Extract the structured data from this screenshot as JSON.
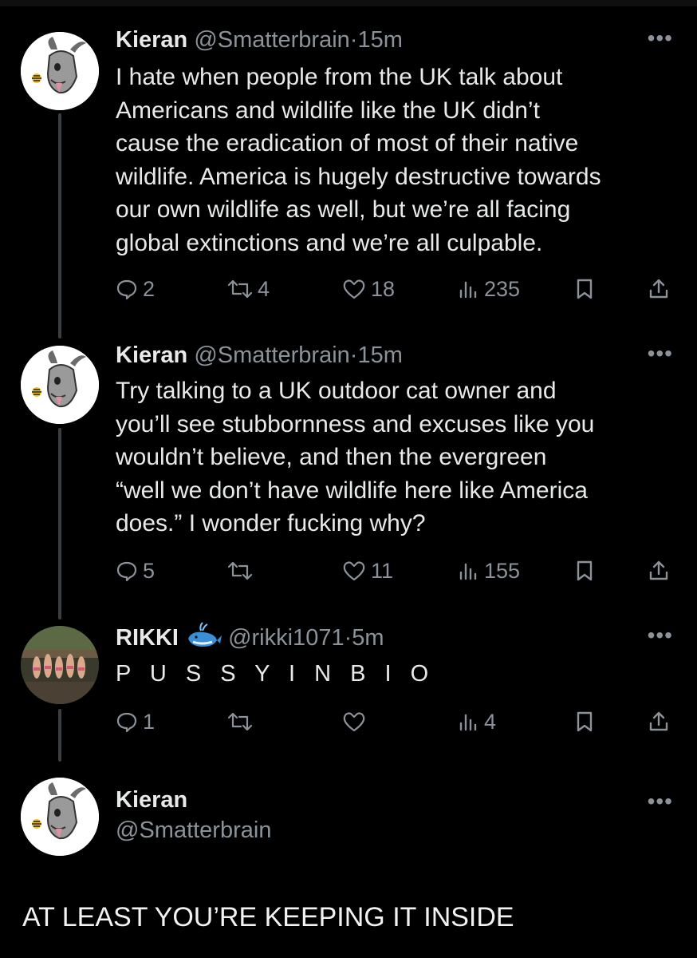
{
  "tweets": [
    {
      "name": "Kieran",
      "handle": "@Smatterbrain",
      "dot": "·",
      "time": "15m",
      "text": "I hate when people from the UK talk about\nAmericans and wildlife like  the UK didn’t\ncause the eradication of most of their native\nwildlife. America is hugely destructive towards\nour own wildlife as well, but we’re all facing\nglobal extinctions and we’re all culpable.",
      "replies": "2",
      "reposts": "4",
      "likes": "18",
      "views": "235"
    },
    {
      "name": "Kieran",
      "handle": "@Smatterbrain",
      "dot": "·",
      "time": "15m",
      "text": "Try talking to a UK outdoor cat owner and\nyou’ll see stubbornness and excuses like you\nwouldn’t believe, and then the evergreen\n“well we don’t have wildlife here like America\ndoes.” I wonder fucking why?",
      "replies": "5",
      "reposts": "",
      "likes": "11",
      "views": "155"
    },
    {
      "name": "RIKKI",
      "handle": "@rikki1071",
      "dot": "·",
      "time": "5m",
      "text": "P U S S Y  I N B I O",
      "replies": "1",
      "reposts": "",
      "likes": "",
      "views": "4"
    }
  ],
  "final_tweet": {
    "name": "Kieran",
    "handle": "@Smatterbrain"
  },
  "caption": "AT LEAST YOU’RE KEEPING IT INSIDE",
  "icons": {
    "reply": "reply-icon",
    "repost": "repost-icon",
    "like": "heart-icon",
    "views": "views-icon",
    "bookmark": "bookmark-icon",
    "share": "share-icon",
    "more": "more-icon",
    "badge": "whale-emoji-icon"
  },
  "colors": {
    "background": "#000000",
    "text": "#e7e9ea",
    "muted": "#8b9299",
    "thread_line": "#3b3f44"
  }
}
